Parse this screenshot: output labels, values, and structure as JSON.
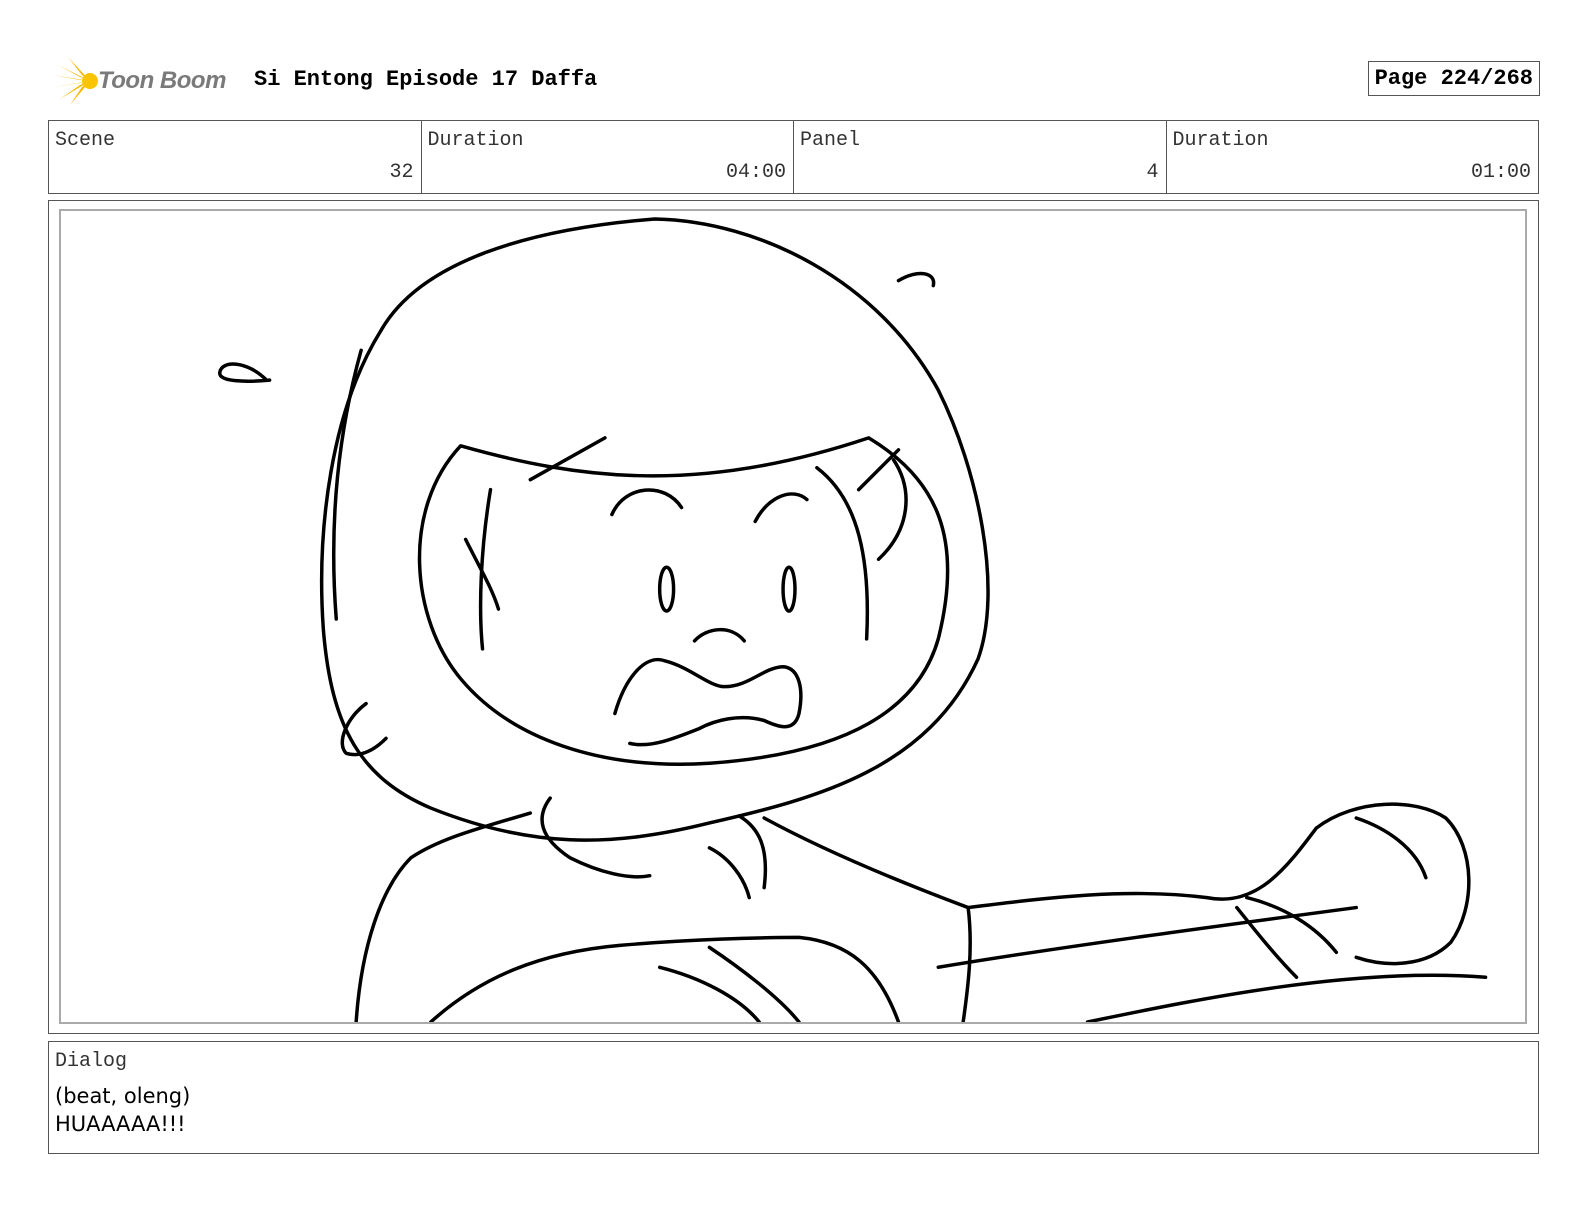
{
  "header": {
    "logo_text": "Toon Boom",
    "logo_icon": "sunburst-icon",
    "title": "Si Entong Episode 17 Daffa",
    "page": "Page 224/268"
  },
  "info": {
    "scene_label": "Scene",
    "scene_value": "32",
    "scene_duration_label": "Duration",
    "scene_duration_value": "04:00",
    "panel_label": "Panel",
    "panel_value": "4",
    "panel_duration_label": "Duration",
    "panel_duration_value": "01:00"
  },
  "dialog": {
    "label": "Dialog",
    "line1": "(beat, oleng)",
    "line2": "HUAAAAA!!!"
  },
  "colors": {
    "logo_accent": "#f5b800",
    "border": "#555555"
  }
}
